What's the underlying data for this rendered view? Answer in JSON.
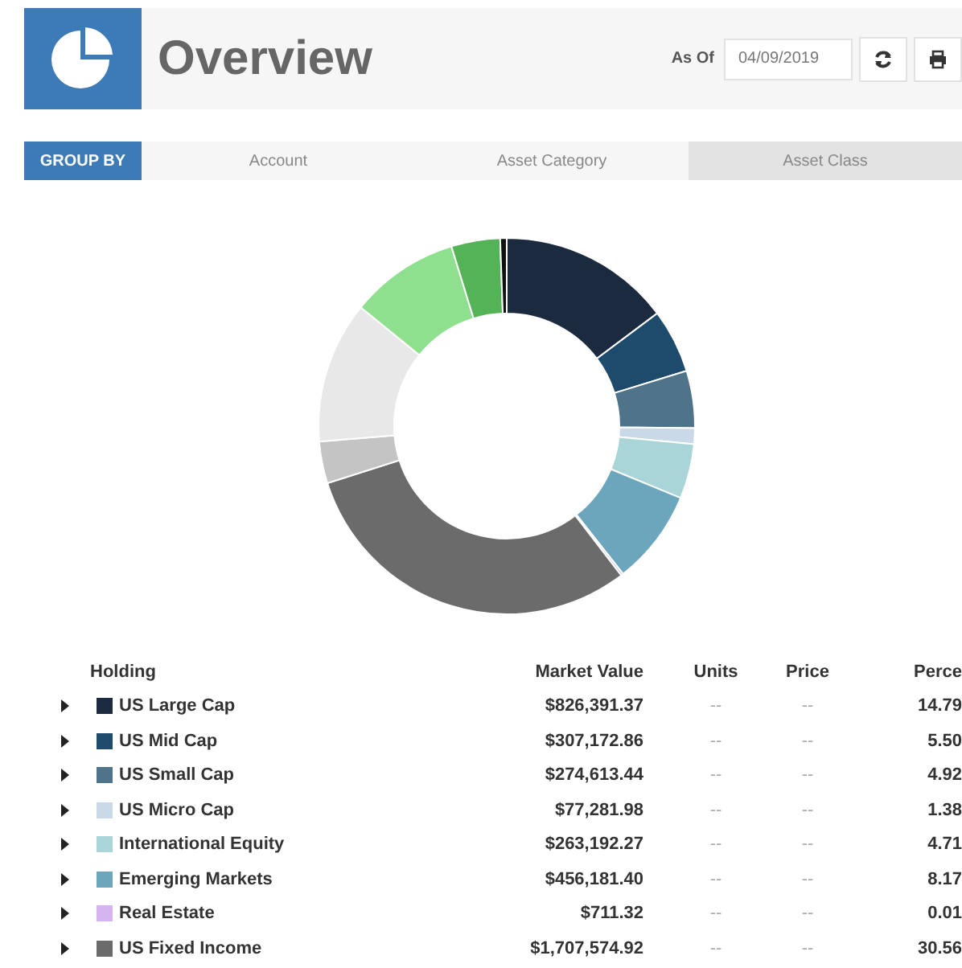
{
  "header": {
    "title": "Overview",
    "as_of_label": "As Of",
    "date": "04/09/2019"
  },
  "group_by": {
    "label": "GROUP BY",
    "tabs": [
      {
        "label": "Account",
        "selected": false
      },
      {
        "label": "Asset Category",
        "selected": false
      },
      {
        "label": "Asset Class",
        "selected": true
      }
    ]
  },
  "table": {
    "columns": [
      "Holding",
      "Market Value",
      "Units",
      "Price",
      "Perce"
    ],
    "rows": [
      {
        "expanded": false,
        "holding": "US Large Cap",
        "color": "#1b2a3f",
        "market_value": "$826,391.37",
        "units": "--",
        "price": "--",
        "percent": "14.79"
      },
      {
        "expanded": false,
        "holding": "US Mid Cap",
        "color": "#1e4a6b",
        "market_value": "$307,172.86",
        "units": "--",
        "price": "--",
        "percent": "5.50"
      },
      {
        "expanded": false,
        "holding": "US Small Cap",
        "color": "#4f7389",
        "market_value": "$274,613.44",
        "units": "--",
        "price": "--",
        "percent": "4.92"
      },
      {
        "expanded": false,
        "holding": "US Micro Cap",
        "color": "#c9d9e8",
        "market_value": "$77,281.98",
        "units": "--",
        "price": "--",
        "percent": "1.38"
      },
      {
        "expanded": false,
        "holding": "International Equity",
        "color": "#a9d5d9",
        "market_value": "$263,192.27",
        "units": "--",
        "price": "--",
        "percent": "4.71"
      },
      {
        "expanded": false,
        "holding": "Emerging Markets",
        "color": "#6ca6bd",
        "market_value": "$456,181.40",
        "units": "--",
        "price": "--",
        "percent": "8.17"
      },
      {
        "expanded": false,
        "holding": "Real Estate",
        "color": "#d4b5ef",
        "market_value": "$711.32",
        "units": "--",
        "price": "--",
        "percent": "0.01"
      },
      {
        "expanded": false,
        "holding": "US Fixed Income",
        "color": "#6b6b6b",
        "market_value": "$1,707,574.92",
        "units": "--",
        "price": "--",
        "percent": "30.56"
      }
    ]
  }
}
